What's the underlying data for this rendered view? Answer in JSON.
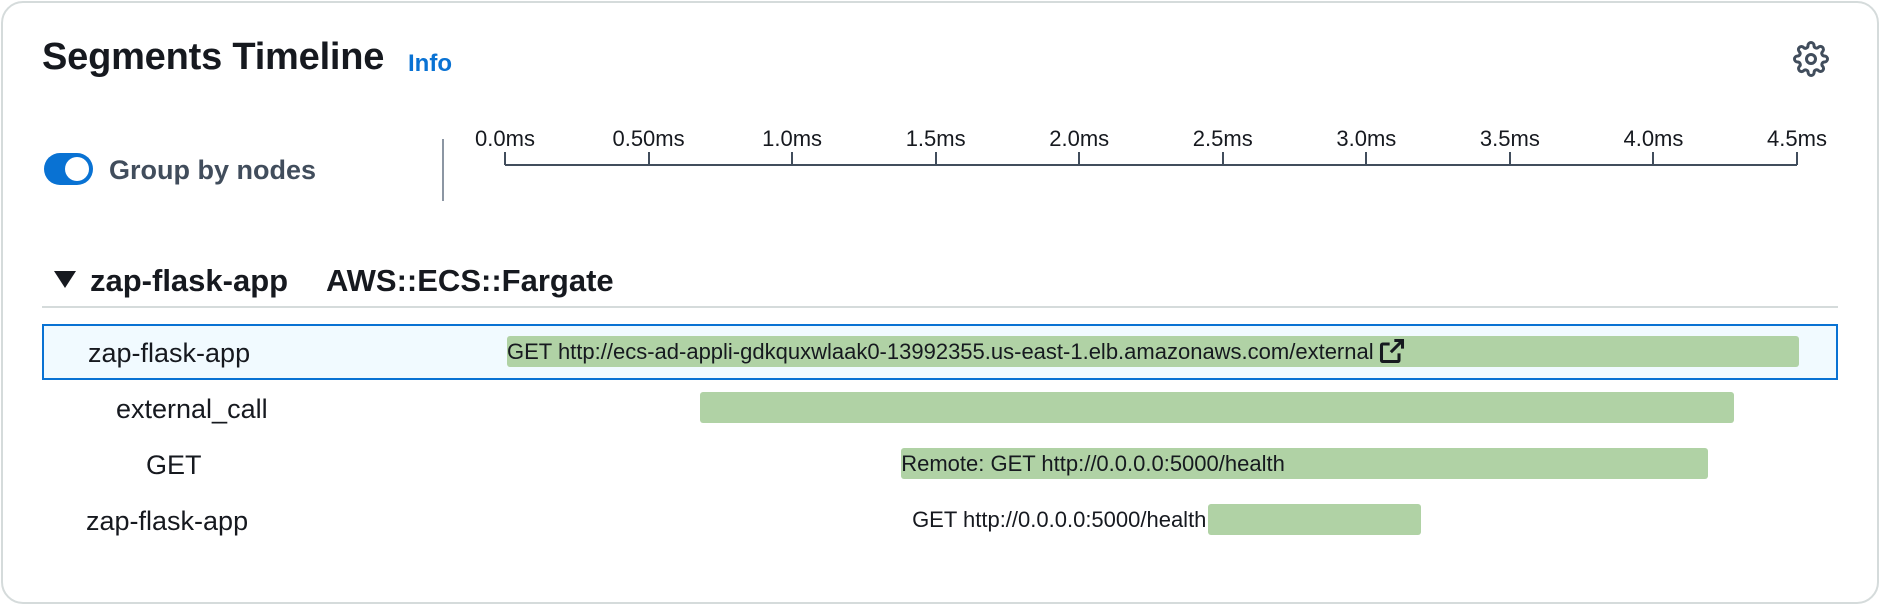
{
  "header": {
    "title": "Segments Timeline",
    "info_label": "Info"
  },
  "icons": {
    "settings": "gear-icon",
    "collapse": "caret-down-icon",
    "external_link": "external-link-icon"
  },
  "toggle": {
    "label": "Group by nodes",
    "checked": true
  },
  "axis": {
    "ticks": [
      "0.0ms",
      "0.50ms",
      "1.0ms",
      "1.5ms",
      "2.0ms",
      "2.5ms",
      "3.0ms",
      "3.5ms",
      "4.0ms",
      "4.5ms"
    ],
    "max_ms": 4.5
  },
  "node": {
    "name": "zap-flask-app",
    "type": "AWS::ECS::Fargate"
  },
  "segments": [
    {
      "label": "zap-flask-app",
      "bar_text": "GET http://ecs-ad-appli-gdkquxwlaak0-13992355.us-east-1.elb.amazonaws.com/external",
      "start_ms": 0.0,
      "end_ms": 4.5,
      "selected": true,
      "external_link": true
    },
    {
      "label": "external_call",
      "bar_text": "",
      "start_ms": 0.68,
      "end_ms": 4.28,
      "selected": false,
      "external_link": false
    },
    {
      "label": "GET",
      "bar_text": "Remote: GET http://0.0.0.0:5000/health",
      "start_ms": 1.38,
      "end_ms": 4.19,
      "selected": false,
      "external_link": false
    },
    {
      "label": "zap-flask-app",
      "bar_text": "GET http://0.0.0.0:5000/health",
      "start_ms": 2.45,
      "end_ms": 3.19,
      "selected": false,
      "external_link": false
    }
  ],
  "colors": {
    "accent": "#0972d3",
    "bar": "#b0d2a5",
    "selected_row_bg": "#f1faff"
  }
}
